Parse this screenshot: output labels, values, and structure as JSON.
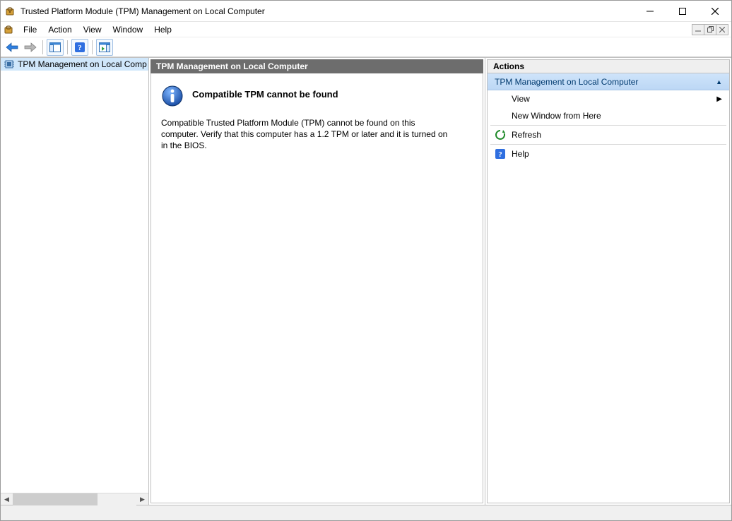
{
  "window": {
    "title": "Trusted Platform Module (TPM) Management on Local Computer"
  },
  "menu": {
    "file": "File",
    "action": "Action",
    "view": "View",
    "window": "Window",
    "help": "Help"
  },
  "tree": {
    "root_label": "TPM Management on Local Comp"
  },
  "center": {
    "header": "TPM Management on Local Computer",
    "info_title": "Compatible TPM cannot be found",
    "info_desc": "Compatible Trusted Platform Module (TPM) cannot be found on this computer. Verify that this computer has a 1.2 TPM or later and it is turned on in the BIOS."
  },
  "actions": {
    "header": "Actions",
    "section_title": "TPM Management on Local Computer",
    "items": {
      "view": "View",
      "new_window": "New Window from Here",
      "refresh": "Refresh",
      "help": "Help"
    }
  }
}
